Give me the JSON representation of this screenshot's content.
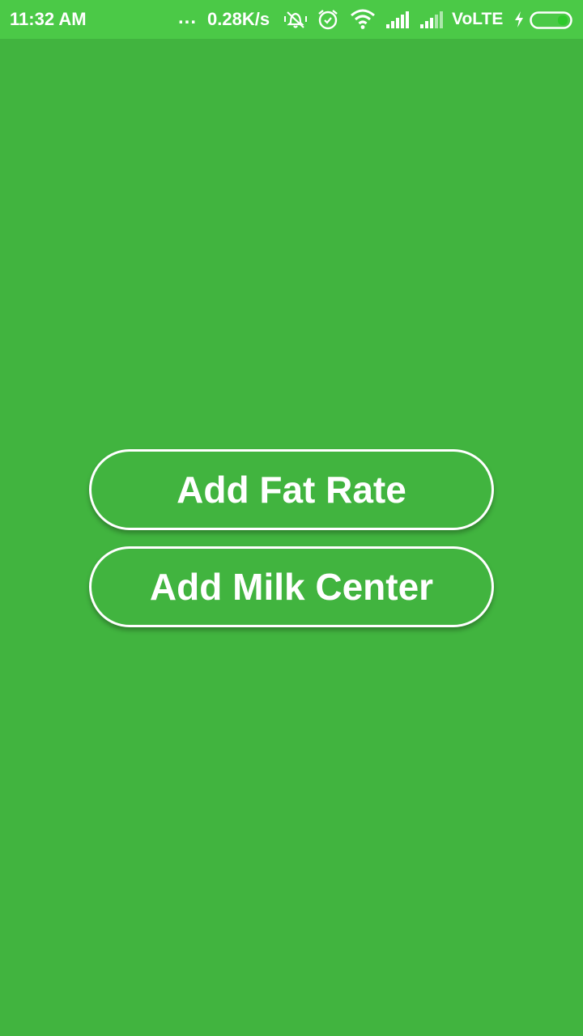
{
  "status_bar": {
    "time": "11:32 AM",
    "dots": "...",
    "network_speed": "0.28K/s",
    "icons": [
      "mute-vibrate-icon",
      "alarm-icon",
      "wifi-icon",
      "signal-icon",
      "signal-icon",
      "battery-charging-icon"
    ],
    "network_type": "VoLTE"
  },
  "main": {
    "add_fat_rate_label": "Add Fat Rate",
    "add_milk_center_label": "Add Milk Center"
  },
  "colors": {
    "background": "#41b43f",
    "status_bar": "#4bc947",
    "button_border": "#ffffff",
    "text": "#ffffff"
  }
}
